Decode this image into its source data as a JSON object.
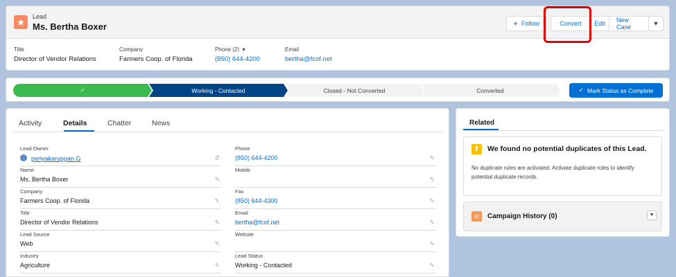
{
  "header": {
    "object_label": "Lead",
    "record_name": "Ms. Bertha Boxer",
    "buttons": {
      "follow": "Follow",
      "convert": "Convert",
      "edit": "Edit",
      "new_case": "New Case",
      "menu_icon": "▼"
    },
    "fields": [
      {
        "label": "Title",
        "value": "Director of Vendor Relations"
      },
      {
        "label": "Company",
        "value": "Farmers Coop. of Florida"
      },
      {
        "label": "Phone (2)",
        "value": "(850) 644-4200"
      },
      {
        "label": "Email",
        "value": "bertha@fcof.net"
      }
    ]
  },
  "path": {
    "stages": [
      {
        "label": "✓",
        "state": "complete"
      },
      {
        "label": "Working - Contacted",
        "state": "current"
      },
      {
        "label": "Closed - Not Converted",
        "state": "incomplete"
      },
      {
        "label": "Converted",
        "state": "incomplete"
      }
    ],
    "mark_button": "Mark Status as Complete"
  },
  "details": {
    "tabs": [
      "Activity",
      "Details",
      "Chatter",
      "News"
    ],
    "active_tab": "Details",
    "left_fields": [
      {
        "label": "Lead Owner",
        "value": "periyakaruppan G"
      },
      {
        "label": "Name",
        "value": "Ms. Bertha Boxer"
      },
      {
        "label": "Company",
        "value": "Farmers Coop. of Florida"
      },
      {
        "label": "Title",
        "value": "Director of Vendor Relations"
      },
      {
        "label": "Lead Source",
        "value": "Web"
      },
      {
        "label": "Industry",
        "value": "Agriculture"
      }
    ],
    "right_fields": [
      {
        "label": "Phone",
        "value": "(850) 644-4200"
      },
      {
        "label": "Mobile",
        "value": ""
      },
      {
        "label": "Fax",
        "value": "(850) 644-4300"
      },
      {
        "label": "Email",
        "value": "bertha@fcof.net"
      },
      {
        "label": "Website",
        "value": ""
      },
      {
        "label": "Lead Status",
        "value": "Working - Contacted"
      }
    ]
  },
  "related": {
    "tab": "Related",
    "duplicates_title": "We found no potential duplicates of this Lead.",
    "duplicates_text": "No duplicate rules are activated. Activate duplicate rules to identify potential duplicate records.",
    "campaign_title": "Campaign History (0)"
  },
  "colors": {
    "brand": "#0070d2",
    "path_complete": "#3dba4e",
    "path_current": "#014486",
    "lead_icon": "#f88962",
    "highlight": "#e00000"
  }
}
